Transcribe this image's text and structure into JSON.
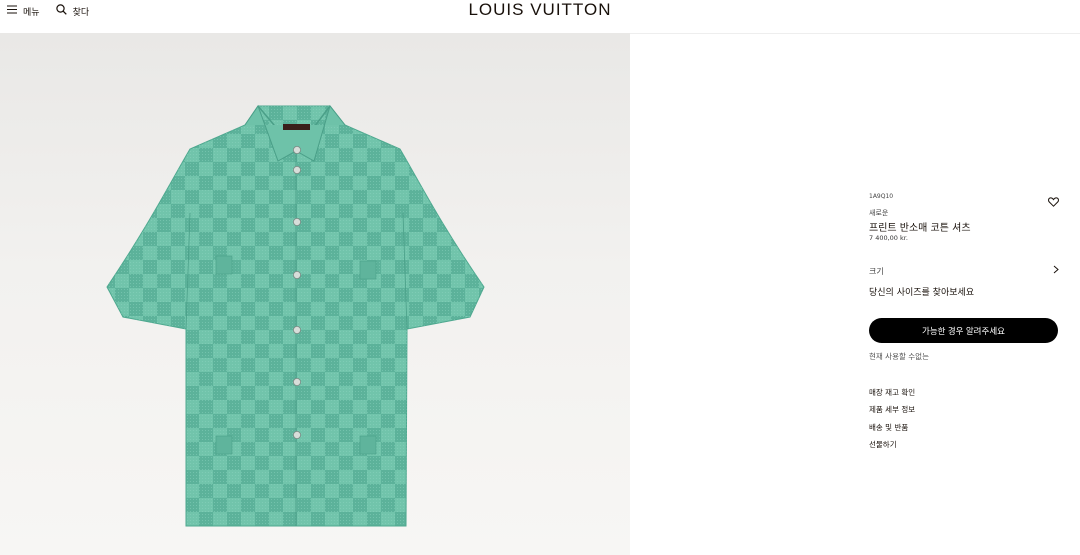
{
  "header": {
    "menu_label": "메뉴",
    "search_label": "찾다",
    "brand": "LOUIS VUITTON"
  },
  "product": {
    "sku": "1A9Q10",
    "collection": "새로운",
    "name": "프린트 반소매 코튼 셔츠",
    "price": "7 400,00 kr.",
    "size_label": "크기",
    "size_hint": "당신의 사이즈를 찾아보세요",
    "cta_label": "가능한 경우 알려주세요",
    "availability": "현재 사용할 수없는"
  },
  "links": [
    "매장 재고 확인",
    "제품 세부 정보",
    "배송 및 반품",
    "선물하기"
  ],
  "colors": {
    "shirt": "#6cc0a7",
    "cta_bg": "#000000"
  }
}
